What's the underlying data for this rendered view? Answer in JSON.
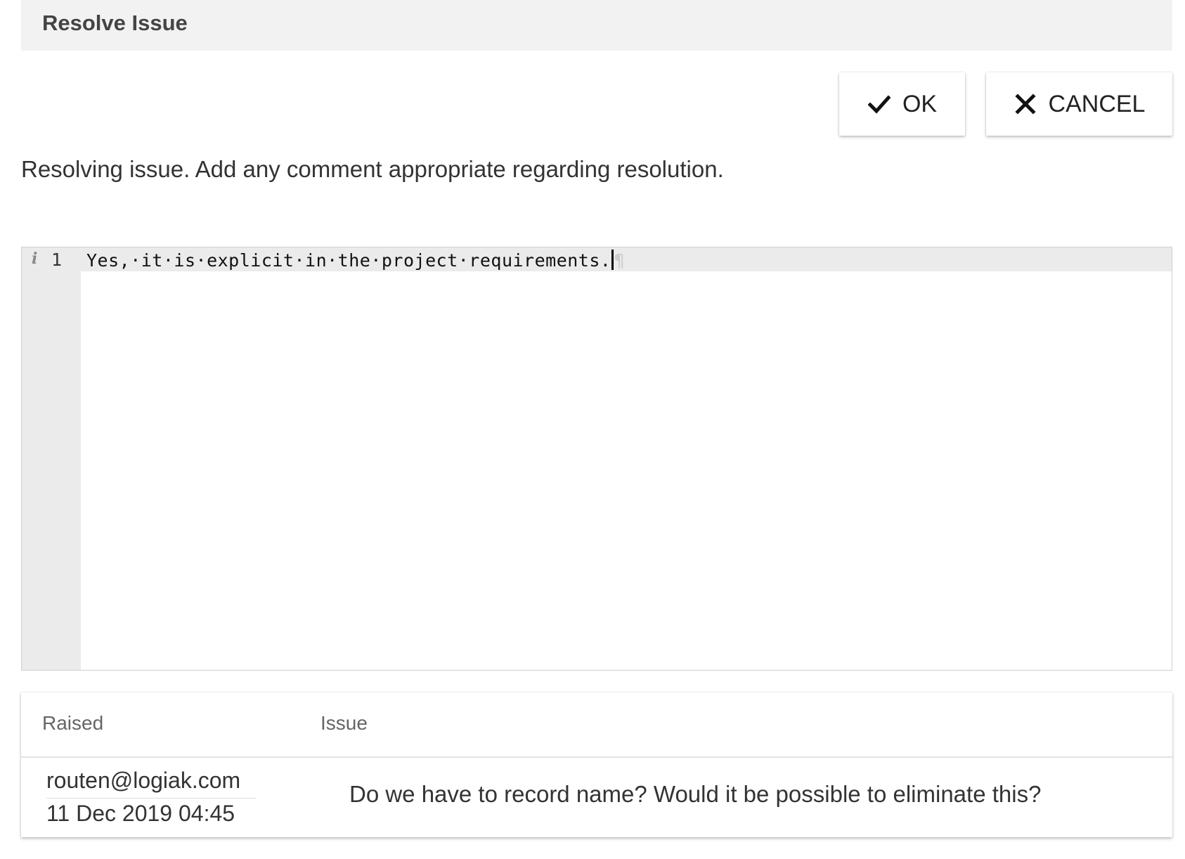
{
  "dialog": {
    "title": "Resolve Issue"
  },
  "actions": {
    "ok_label": "OK",
    "cancel_label": "CANCEL"
  },
  "instruction_text": "Resolving issue. Add any comment appropriate regarding resolution.",
  "editor": {
    "line_marker": "i",
    "line_number": "1",
    "content": "Yes,·it·is·explicit·in·the·project·requirements.",
    "end_marker": "¶"
  },
  "issue_table": {
    "columns": {
      "raised": "Raised",
      "issue": "Issue"
    },
    "row": {
      "raised_by": "routen@logiak.com",
      "raised_at": "11 Dec 2019 04:45",
      "issue": "Do we have to record name? Would it be possible to eliminate this?"
    }
  }
}
